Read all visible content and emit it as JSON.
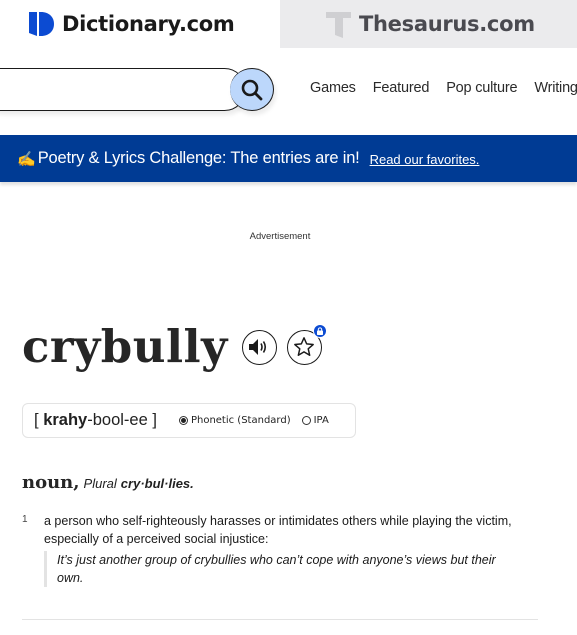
{
  "brands": {
    "dictionary": "Dictionary.com",
    "thesaurus": "Thesaurus.com"
  },
  "search": {
    "value": "",
    "placeholder": "",
    "button_label": "Search"
  },
  "nav": {
    "items": [
      {
        "label": "Games"
      },
      {
        "label": "Featured"
      },
      {
        "label": "Pop culture"
      },
      {
        "label": "Writing tips"
      }
    ]
  },
  "banner": {
    "emoji": "✍️",
    "text": "Poetry & Lyrics Challenge: The entries are in!",
    "link": "Read our favorites."
  },
  "ad": {
    "label": "Advertisement"
  },
  "entry": {
    "headword": "crybully",
    "pronunciation": {
      "open_bracket": "[",
      "stressed": "krahy",
      "rest": "-bool-ee",
      "close_bracket": "]"
    },
    "pron_options": [
      {
        "label": "Phonetic (Standard)",
        "checked": true
      },
      {
        "label": "IPA",
        "checked": false
      }
    ],
    "part_of_speech": "noun,",
    "plural_label": "Plural",
    "plural_form": "cry·bul·lies.",
    "definitions": [
      {
        "number": "1",
        "text": "a person who self-righteously harasses or intimidates others while playing the victim, especially of a perceived social injustice:",
        "example": "It’s just another group of crybullies who can’t cope with anyone’s views but their own."
      }
    ]
  },
  "colors": {
    "brand_blue": "#0c4bd2",
    "banner_bg": "#003b94",
    "search_button_bg": "#bcd7fb",
    "thesaurus_bg": "#ebebed"
  }
}
